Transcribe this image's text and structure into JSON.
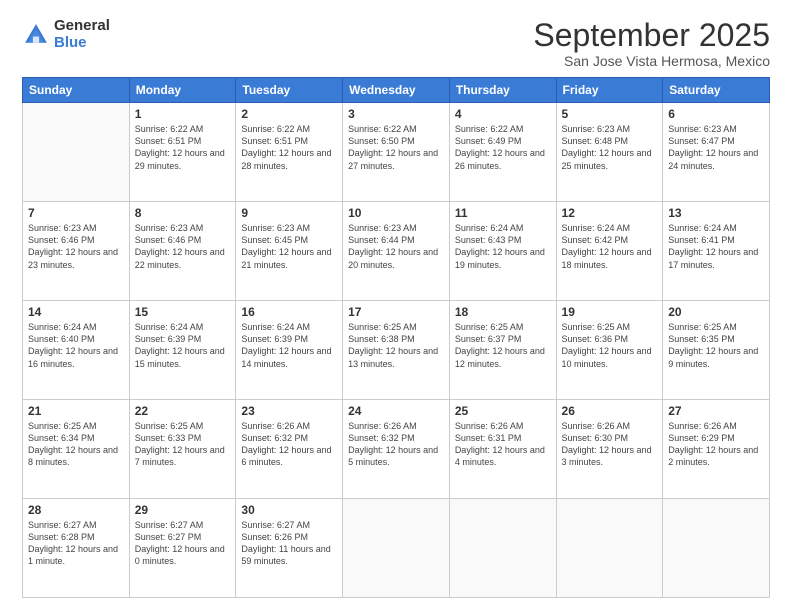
{
  "logo": {
    "general": "General",
    "blue": "Blue"
  },
  "title": "September 2025",
  "subtitle": "San Jose Vista Hermosa, Mexico",
  "days_of_week": [
    "Sunday",
    "Monday",
    "Tuesday",
    "Wednesday",
    "Thursday",
    "Friday",
    "Saturday"
  ],
  "weeks": [
    [
      {
        "num": "",
        "info": ""
      },
      {
        "num": "1",
        "info": "Sunrise: 6:22 AM\nSunset: 6:51 PM\nDaylight: 12 hours\nand 29 minutes."
      },
      {
        "num": "2",
        "info": "Sunrise: 6:22 AM\nSunset: 6:51 PM\nDaylight: 12 hours\nand 28 minutes."
      },
      {
        "num": "3",
        "info": "Sunrise: 6:22 AM\nSunset: 6:50 PM\nDaylight: 12 hours\nand 27 minutes."
      },
      {
        "num": "4",
        "info": "Sunrise: 6:22 AM\nSunset: 6:49 PM\nDaylight: 12 hours\nand 26 minutes."
      },
      {
        "num": "5",
        "info": "Sunrise: 6:23 AM\nSunset: 6:48 PM\nDaylight: 12 hours\nand 25 minutes."
      },
      {
        "num": "6",
        "info": "Sunrise: 6:23 AM\nSunset: 6:47 PM\nDaylight: 12 hours\nand 24 minutes."
      }
    ],
    [
      {
        "num": "7",
        "info": "Sunrise: 6:23 AM\nSunset: 6:46 PM\nDaylight: 12 hours\nand 23 minutes."
      },
      {
        "num": "8",
        "info": "Sunrise: 6:23 AM\nSunset: 6:46 PM\nDaylight: 12 hours\nand 22 minutes."
      },
      {
        "num": "9",
        "info": "Sunrise: 6:23 AM\nSunset: 6:45 PM\nDaylight: 12 hours\nand 21 minutes."
      },
      {
        "num": "10",
        "info": "Sunrise: 6:23 AM\nSunset: 6:44 PM\nDaylight: 12 hours\nand 20 minutes."
      },
      {
        "num": "11",
        "info": "Sunrise: 6:24 AM\nSunset: 6:43 PM\nDaylight: 12 hours\nand 19 minutes."
      },
      {
        "num": "12",
        "info": "Sunrise: 6:24 AM\nSunset: 6:42 PM\nDaylight: 12 hours\nand 18 minutes."
      },
      {
        "num": "13",
        "info": "Sunrise: 6:24 AM\nSunset: 6:41 PM\nDaylight: 12 hours\nand 17 minutes."
      }
    ],
    [
      {
        "num": "14",
        "info": "Sunrise: 6:24 AM\nSunset: 6:40 PM\nDaylight: 12 hours\nand 16 minutes."
      },
      {
        "num": "15",
        "info": "Sunrise: 6:24 AM\nSunset: 6:39 PM\nDaylight: 12 hours\nand 15 minutes."
      },
      {
        "num": "16",
        "info": "Sunrise: 6:24 AM\nSunset: 6:39 PM\nDaylight: 12 hours\nand 14 minutes."
      },
      {
        "num": "17",
        "info": "Sunrise: 6:25 AM\nSunset: 6:38 PM\nDaylight: 12 hours\nand 13 minutes."
      },
      {
        "num": "18",
        "info": "Sunrise: 6:25 AM\nSunset: 6:37 PM\nDaylight: 12 hours\nand 12 minutes."
      },
      {
        "num": "19",
        "info": "Sunrise: 6:25 AM\nSunset: 6:36 PM\nDaylight: 12 hours\nand 10 minutes."
      },
      {
        "num": "20",
        "info": "Sunrise: 6:25 AM\nSunset: 6:35 PM\nDaylight: 12 hours\nand 9 minutes."
      }
    ],
    [
      {
        "num": "21",
        "info": "Sunrise: 6:25 AM\nSunset: 6:34 PM\nDaylight: 12 hours\nand 8 minutes."
      },
      {
        "num": "22",
        "info": "Sunrise: 6:25 AM\nSunset: 6:33 PM\nDaylight: 12 hours\nand 7 minutes."
      },
      {
        "num": "23",
        "info": "Sunrise: 6:26 AM\nSunset: 6:32 PM\nDaylight: 12 hours\nand 6 minutes."
      },
      {
        "num": "24",
        "info": "Sunrise: 6:26 AM\nSunset: 6:32 PM\nDaylight: 12 hours\nand 5 minutes."
      },
      {
        "num": "25",
        "info": "Sunrise: 6:26 AM\nSunset: 6:31 PM\nDaylight: 12 hours\nand 4 minutes."
      },
      {
        "num": "26",
        "info": "Sunrise: 6:26 AM\nSunset: 6:30 PM\nDaylight: 12 hours\nand 3 minutes."
      },
      {
        "num": "27",
        "info": "Sunrise: 6:26 AM\nSunset: 6:29 PM\nDaylight: 12 hours\nand 2 minutes."
      }
    ],
    [
      {
        "num": "28",
        "info": "Sunrise: 6:27 AM\nSunset: 6:28 PM\nDaylight: 12 hours\nand 1 minute."
      },
      {
        "num": "29",
        "info": "Sunrise: 6:27 AM\nSunset: 6:27 PM\nDaylight: 12 hours\nand 0 minutes."
      },
      {
        "num": "30",
        "info": "Sunrise: 6:27 AM\nSunset: 6:26 PM\nDaylight: 11 hours\nand 59 minutes."
      },
      {
        "num": "",
        "info": ""
      },
      {
        "num": "",
        "info": ""
      },
      {
        "num": "",
        "info": ""
      },
      {
        "num": "",
        "info": ""
      }
    ]
  ]
}
